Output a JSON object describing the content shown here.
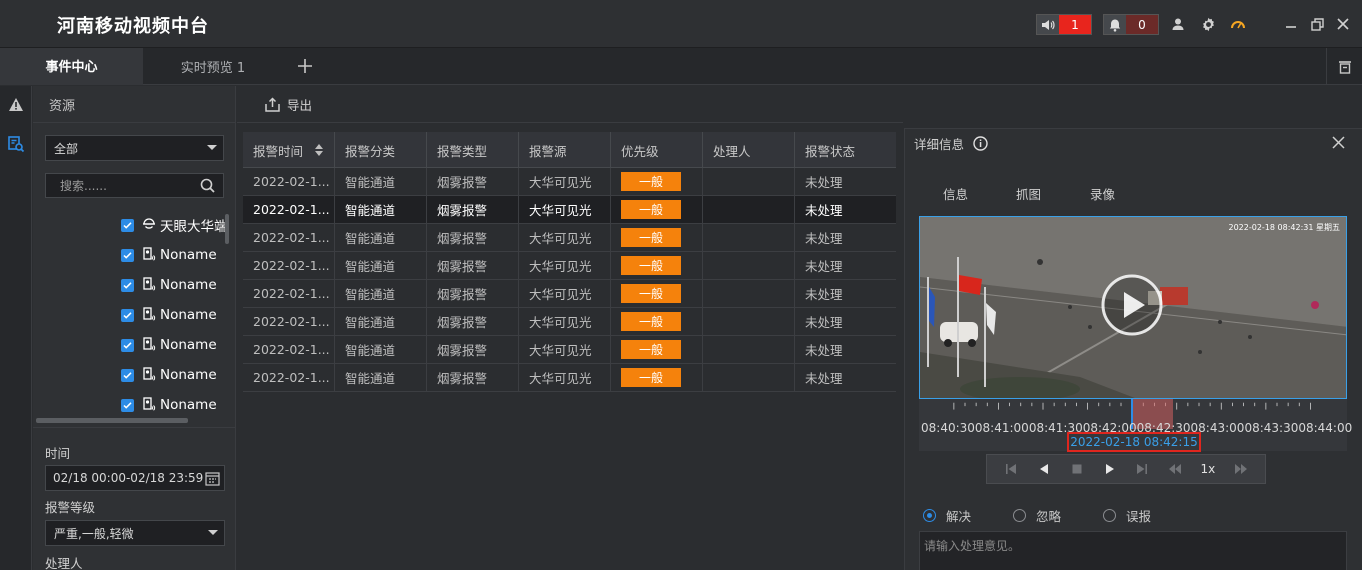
{
  "app": {
    "title": "河南移动视频中台"
  },
  "titlebar": {
    "sound_count": "1",
    "alarm_count": "0",
    "colors": {
      "sound_badge": "#e8251d",
      "alarm_badge": "#6b2a28",
      "gauge": "#f5a623"
    }
  },
  "tabs": [
    {
      "label": "事件中心",
      "active": true
    },
    {
      "label": "实时预览 1",
      "active": false
    }
  ],
  "resource": {
    "title": "资源",
    "filter_value": "全部",
    "search_placeholder": "搜索......",
    "tree": [
      {
        "label": "天眼大华端",
        "icon": "dome-camera-icon",
        "checked": true
      },
      {
        "label": "Noname",
        "icon": "camera-channel-icon",
        "checked": true
      },
      {
        "label": "Noname",
        "icon": "camera-channel-icon",
        "checked": true
      },
      {
        "label": "Noname",
        "icon": "camera-channel-icon",
        "checked": true
      },
      {
        "label": "Noname",
        "icon": "camera-channel-icon",
        "checked": true
      },
      {
        "label": "Noname",
        "icon": "camera-channel-icon",
        "checked": true
      },
      {
        "label": "Noname",
        "icon": "camera-channel-icon",
        "checked": true
      }
    ],
    "time_label": "时间",
    "time_value": "02/18 00:00-02/18 23:59",
    "level_label": "报警等级",
    "level_value": "严重,一般,轻微",
    "handler_label": "处理人"
  },
  "toolbar": {
    "export_label": "导出"
  },
  "table": {
    "columns": [
      "报警时间",
      "报警分类",
      "报警类型",
      "报警源",
      "优先级",
      "处理人",
      "报警状态"
    ],
    "rows": [
      {
        "time": "2022-02-1...",
        "category": "智能通道",
        "type": "烟雾报警",
        "source": "大华可见光",
        "priority": "一般",
        "handler": "",
        "status": "未处理",
        "selected": false
      },
      {
        "time": "2022-02-1...",
        "category": "智能通道",
        "type": "烟雾报警",
        "source": "大华可见光",
        "priority": "一般",
        "handler": "",
        "status": "未处理",
        "selected": true
      },
      {
        "time": "2022-02-1...",
        "category": "智能通道",
        "type": "烟雾报警",
        "source": "大华可见光",
        "priority": "一般",
        "handler": "",
        "status": "未处理",
        "selected": false
      },
      {
        "time": "2022-02-1...",
        "category": "智能通道",
        "type": "烟雾报警",
        "source": "大华可见光",
        "priority": "一般",
        "handler": "",
        "status": "未处理",
        "selected": false
      },
      {
        "time": "2022-02-1...",
        "category": "智能通道",
        "type": "烟雾报警",
        "source": "大华可见光",
        "priority": "一般",
        "handler": "",
        "status": "未处理",
        "selected": false
      },
      {
        "time": "2022-02-1...",
        "category": "智能通道",
        "type": "烟雾报警",
        "source": "大华可见光",
        "priority": "一般",
        "handler": "",
        "status": "未处理",
        "selected": false
      },
      {
        "time": "2022-02-1...",
        "category": "智能通道",
        "type": "烟雾报警",
        "source": "大华可见光",
        "priority": "一般",
        "handler": "",
        "status": "未处理",
        "selected": false
      },
      {
        "time": "2022-02-1...",
        "category": "智能通道",
        "type": "烟雾报警",
        "source": "大华可见光",
        "priority": "一般",
        "handler": "",
        "status": "未处理",
        "selected": false
      }
    ],
    "priority_color": "#f5820c"
  },
  "detail": {
    "title": "详细信息",
    "tabs": [
      "信息",
      "抓图",
      "录像"
    ],
    "video_overlay_time": "2022-02-18 08:42:31 星期五",
    "timeline_labels": [
      "08:40:30",
      "08:41:00",
      "08:41:30",
      "08:42:00",
      "08:42:30",
      "08:43:00",
      "08:43:30",
      "08:44:00"
    ],
    "current_time": "2022-02-18 08:42:15",
    "speed": "1x",
    "options": [
      {
        "label": "解决",
        "selected": true
      },
      {
        "label": "忽略",
        "selected": false
      },
      {
        "label": "误报",
        "selected": false
      }
    ],
    "opinion_placeholder": "请输入处理意见。"
  }
}
